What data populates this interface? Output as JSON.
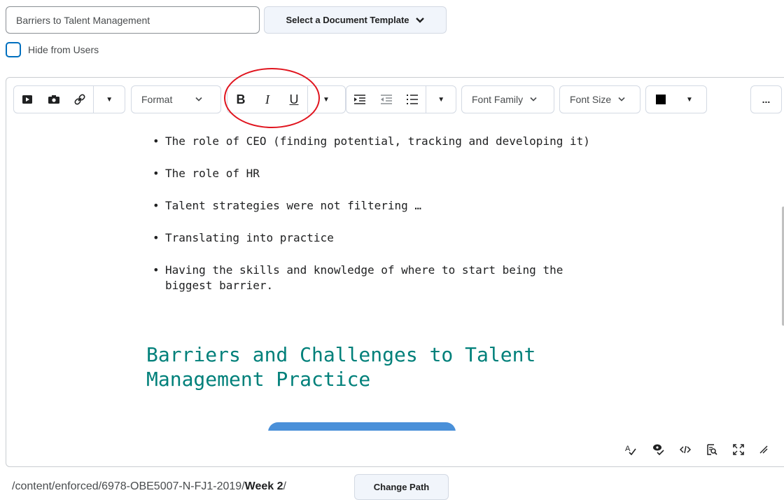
{
  "title_input": {
    "value": "Barriers to Talent Management"
  },
  "template_button": {
    "label": "Select a Document Template"
  },
  "hide_option": {
    "label": "Hide from Users",
    "checked": false
  },
  "toolbar": {
    "insert_group": [
      "insert-media-icon",
      "insert-image-icon",
      "insert-link-icon",
      "more-insert-icon"
    ],
    "format_label": "Format",
    "bold": "B",
    "italic": "I",
    "underline": "U",
    "font_family_label": "Font Family",
    "font_size_label": "Font Size",
    "font_color": "#000000",
    "more_label": "..."
  },
  "content": {
    "bullets": [
      "The role of CEO (finding potential, tracking and developing it)",
      "The role of HR",
      "Talent strategies were not filtering …",
      "Translating into practice",
      "Having the skills and knowledge of where to start being the biggest barrier."
    ],
    "heading": "Barriers and Challenges to Talent Management Practice"
  },
  "status_bar_icons": [
    "spellcheck-icon",
    "accessibility-icon",
    "source-code-icon",
    "preview-icon",
    "fullscreen-icon",
    "resize-icon"
  ],
  "path": {
    "prefix": "/content/enforced/6978-OBE5007-N-FJ1-2019/",
    "folder": "Week 2",
    "suffix": "/"
  },
  "change_path_button": {
    "label": "Change Path"
  },
  "colors": {
    "accent": "#006fbf",
    "heading": "#00807a",
    "annotation": "#e0141e"
  }
}
